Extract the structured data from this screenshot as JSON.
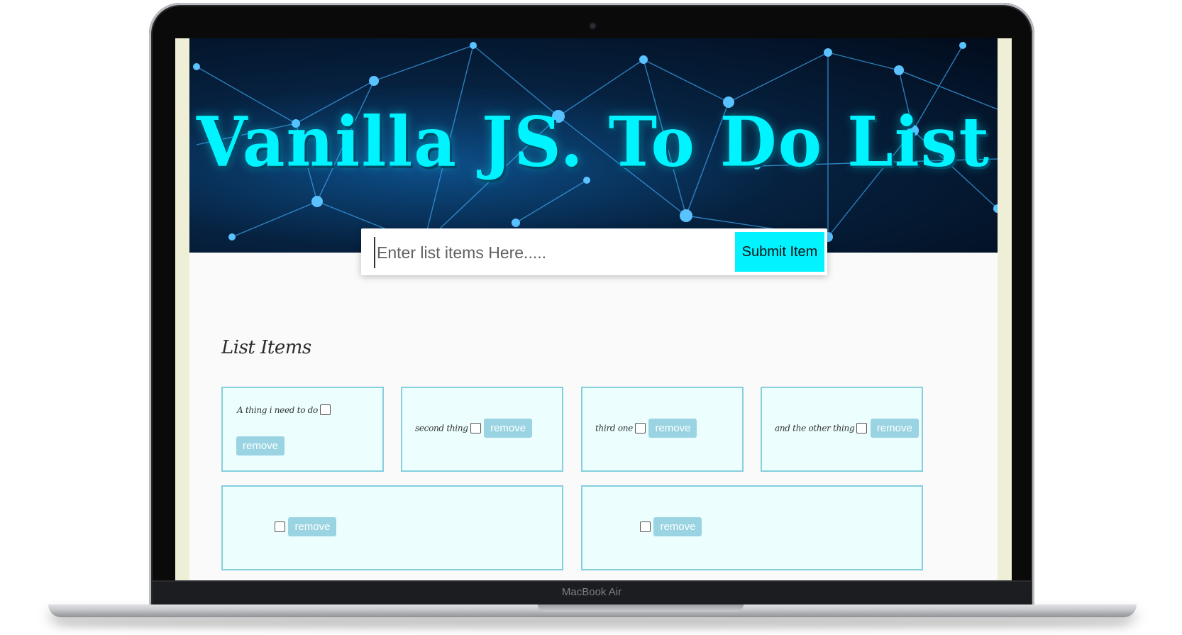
{
  "device": {
    "brand_label": "MacBook Air"
  },
  "header": {
    "title": "Vanilla JS. To Do List"
  },
  "entry": {
    "placeholder": "Enter list items Here.....",
    "submit_label": "Submit Item"
  },
  "list": {
    "title": "List Items",
    "items": [
      {
        "text": "A thing i need to do",
        "remove_label": "remove"
      },
      {
        "text": "second thing",
        "remove_label": "remove"
      },
      {
        "text": "third one",
        "remove_label": "remove"
      },
      {
        "text": "and the other thing",
        "remove_label": "remove"
      },
      {
        "text": "",
        "remove_label": "remove"
      },
      {
        "text": "",
        "remove_label": "remove"
      }
    ]
  },
  "colors": {
    "accent": "#00f3ff",
    "card_bg": "#ecfefe",
    "card_border": "#86cfdc",
    "remove_bg": "#9ad4e2"
  }
}
